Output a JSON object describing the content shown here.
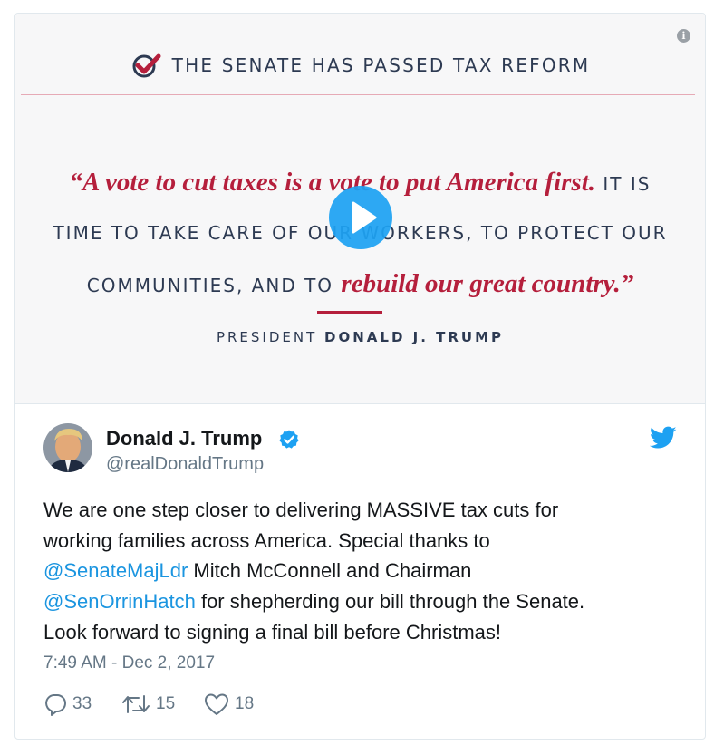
{
  "media": {
    "headline": "THE SENATE HAS PASSED TAX REFORM",
    "quote": {
      "line1_emphasis": "“A vote to cut taxes is a vote to put America first.",
      "line1_rest": "IT IS",
      "line2": "TIME TO TAKE CARE OF OUR WORKERS, TO PROTECT OUR",
      "line3_plain": "COMMUNITIES, AND TO",
      "line3_emphasis": "rebuild our great country.”"
    },
    "attribution": {
      "title": "PRESIDENT",
      "name": "DONALD J. TRUMP"
    },
    "colors": {
      "accent_red": "#b51f3c",
      "navy_text": "#2d3a52",
      "play_blue": "#1da1f2"
    },
    "icons": [
      "check-icon",
      "info-icon",
      "play-icon"
    ]
  },
  "tweet": {
    "author": {
      "name": "Donald J. Trump",
      "handle": "@realDonaldTrump",
      "verified": true
    },
    "text": {
      "l1": "We are one step closer to delivering MASSIVE tax cuts for",
      "l2": "working families across America. Special thanks to",
      "l3_mention": "@SenateMajLdr",
      "l3_rest": " Mitch McConnell and Chairman",
      "l4_mention": "@SenOrrinHatch",
      "l4_rest": " for shepherding our bill through the Senate.",
      "l5": "Look forward to signing a final bill before Christmas!"
    },
    "timestamp": "7:49 AM - Dec 2, 2017",
    "actions": {
      "replies": "33",
      "retweets": "15",
      "likes": "18"
    },
    "colors": {
      "link": "#1b95e0",
      "muted": "#657786",
      "twitter_blue": "#1da1f2"
    },
    "icons": [
      "verified-icon",
      "twitter-bird-icon",
      "reply-icon",
      "retweet-icon",
      "like-icon"
    ]
  }
}
